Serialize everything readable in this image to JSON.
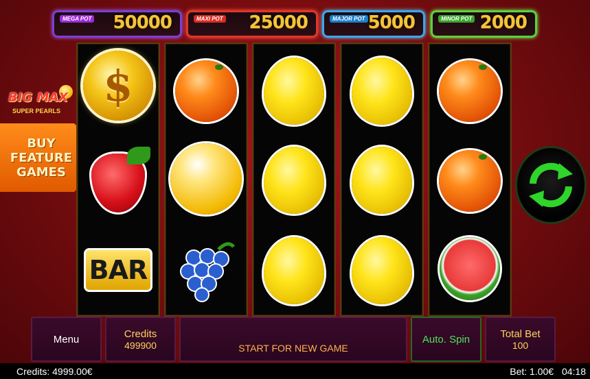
{
  "jackpots": {
    "mega": {
      "label": "MEGA POT",
      "value": "50000",
      "color": "#9c2ad6"
    },
    "maxi": {
      "label": "MAXI POT",
      "value": "25000",
      "color": "#d82d22"
    },
    "major": {
      "label": "MAJOR POT",
      "value": "5000",
      "color": "#1d7ec9"
    },
    "minor": {
      "label": "MINOR POT",
      "value": "2000",
      "color": "#3aa52a"
    }
  },
  "logo": {
    "main": "BIG MAX",
    "sub": "SUPER PEARLS"
  },
  "buy_feature": {
    "label": "BUY\nFEATURE\nGAMES"
  },
  "reels": [
    [
      "dollar-coin",
      "strawberry",
      "bar"
    ],
    [
      "orange",
      "golden-pearl",
      "grapes"
    ],
    [
      "lemon",
      "lemon",
      "lemon"
    ],
    [
      "lemon",
      "lemon",
      "lemon"
    ],
    [
      "orange",
      "orange",
      "watermelon"
    ]
  ],
  "symbols": {
    "dollar": "$",
    "bar": "BAR"
  },
  "controls": {
    "menu": "Menu",
    "credits_label": "Credits",
    "credits_value": "499900",
    "start": "START FOR NEW GAME",
    "auto_spin": "Auto. Spin",
    "total_bet_label": "Total Bet",
    "total_bet_value": "100"
  },
  "status": {
    "credits": "Credits: 4999.00€",
    "bet": "Bet: 1.00€",
    "time": "04:18"
  },
  "spin_button_icon": "refresh-arrows-icon"
}
